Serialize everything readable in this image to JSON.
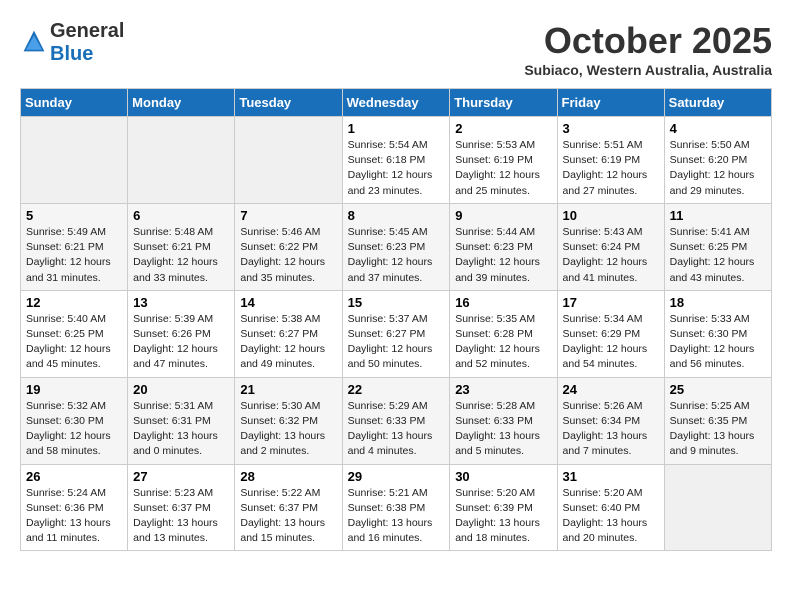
{
  "logo": {
    "line1": "General",
    "line2": "Blue"
  },
  "title": "October 2025",
  "location": "Subiaco, Western Australia, Australia",
  "weekdays": [
    "Sunday",
    "Monday",
    "Tuesday",
    "Wednesday",
    "Thursday",
    "Friday",
    "Saturday"
  ],
  "weeks": [
    [
      {
        "day": "",
        "info": ""
      },
      {
        "day": "",
        "info": ""
      },
      {
        "day": "",
        "info": ""
      },
      {
        "day": "1",
        "info": "Sunrise: 5:54 AM\nSunset: 6:18 PM\nDaylight: 12 hours\nand 23 minutes."
      },
      {
        "day": "2",
        "info": "Sunrise: 5:53 AM\nSunset: 6:19 PM\nDaylight: 12 hours\nand 25 minutes."
      },
      {
        "day": "3",
        "info": "Sunrise: 5:51 AM\nSunset: 6:19 PM\nDaylight: 12 hours\nand 27 minutes."
      },
      {
        "day": "4",
        "info": "Sunrise: 5:50 AM\nSunset: 6:20 PM\nDaylight: 12 hours\nand 29 minutes."
      }
    ],
    [
      {
        "day": "5",
        "info": "Sunrise: 5:49 AM\nSunset: 6:21 PM\nDaylight: 12 hours\nand 31 minutes."
      },
      {
        "day": "6",
        "info": "Sunrise: 5:48 AM\nSunset: 6:21 PM\nDaylight: 12 hours\nand 33 minutes."
      },
      {
        "day": "7",
        "info": "Sunrise: 5:46 AM\nSunset: 6:22 PM\nDaylight: 12 hours\nand 35 minutes."
      },
      {
        "day": "8",
        "info": "Sunrise: 5:45 AM\nSunset: 6:23 PM\nDaylight: 12 hours\nand 37 minutes."
      },
      {
        "day": "9",
        "info": "Sunrise: 5:44 AM\nSunset: 6:23 PM\nDaylight: 12 hours\nand 39 minutes."
      },
      {
        "day": "10",
        "info": "Sunrise: 5:43 AM\nSunset: 6:24 PM\nDaylight: 12 hours\nand 41 minutes."
      },
      {
        "day": "11",
        "info": "Sunrise: 5:41 AM\nSunset: 6:25 PM\nDaylight: 12 hours\nand 43 minutes."
      }
    ],
    [
      {
        "day": "12",
        "info": "Sunrise: 5:40 AM\nSunset: 6:25 PM\nDaylight: 12 hours\nand 45 minutes."
      },
      {
        "day": "13",
        "info": "Sunrise: 5:39 AM\nSunset: 6:26 PM\nDaylight: 12 hours\nand 47 minutes."
      },
      {
        "day": "14",
        "info": "Sunrise: 5:38 AM\nSunset: 6:27 PM\nDaylight: 12 hours\nand 49 minutes."
      },
      {
        "day": "15",
        "info": "Sunrise: 5:37 AM\nSunset: 6:27 PM\nDaylight: 12 hours\nand 50 minutes."
      },
      {
        "day": "16",
        "info": "Sunrise: 5:35 AM\nSunset: 6:28 PM\nDaylight: 12 hours\nand 52 minutes."
      },
      {
        "day": "17",
        "info": "Sunrise: 5:34 AM\nSunset: 6:29 PM\nDaylight: 12 hours\nand 54 minutes."
      },
      {
        "day": "18",
        "info": "Sunrise: 5:33 AM\nSunset: 6:30 PM\nDaylight: 12 hours\nand 56 minutes."
      }
    ],
    [
      {
        "day": "19",
        "info": "Sunrise: 5:32 AM\nSunset: 6:30 PM\nDaylight: 12 hours\nand 58 minutes."
      },
      {
        "day": "20",
        "info": "Sunrise: 5:31 AM\nSunset: 6:31 PM\nDaylight: 13 hours\nand 0 minutes."
      },
      {
        "day": "21",
        "info": "Sunrise: 5:30 AM\nSunset: 6:32 PM\nDaylight: 13 hours\nand 2 minutes."
      },
      {
        "day": "22",
        "info": "Sunrise: 5:29 AM\nSunset: 6:33 PM\nDaylight: 13 hours\nand 4 minutes."
      },
      {
        "day": "23",
        "info": "Sunrise: 5:28 AM\nSunset: 6:33 PM\nDaylight: 13 hours\nand 5 minutes."
      },
      {
        "day": "24",
        "info": "Sunrise: 5:26 AM\nSunset: 6:34 PM\nDaylight: 13 hours\nand 7 minutes."
      },
      {
        "day": "25",
        "info": "Sunrise: 5:25 AM\nSunset: 6:35 PM\nDaylight: 13 hours\nand 9 minutes."
      }
    ],
    [
      {
        "day": "26",
        "info": "Sunrise: 5:24 AM\nSunset: 6:36 PM\nDaylight: 13 hours\nand 11 minutes."
      },
      {
        "day": "27",
        "info": "Sunrise: 5:23 AM\nSunset: 6:37 PM\nDaylight: 13 hours\nand 13 minutes."
      },
      {
        "day": "28",
        "info": "Sunrise: 5:22 AM\nSunset: 6:37 PM\nDaylight: 13 hours\nand 15 minutes."
      },
      {
        "day": "29",
        "info": "Sunrise: 5:21 AM\nSunset: 6:38 PM\nDaylight: 13 hours\nand 16 minutes."
      },
      {
        "day": "30",
        "info": "Sunrise: 5:20 AM\nSunset: 6:39 PM\nDaylight: 13 hours\nand 18 minutes."
      },
      {
        "day": "31",
        "info": "Sunrise: 5:20 AM\nSunset: 6:40 PM\nDaylight: 13 hours\nand 20 minutes."
      },
      {
        "day": "",
        "info": ""
      }
    ]
  ]
}
